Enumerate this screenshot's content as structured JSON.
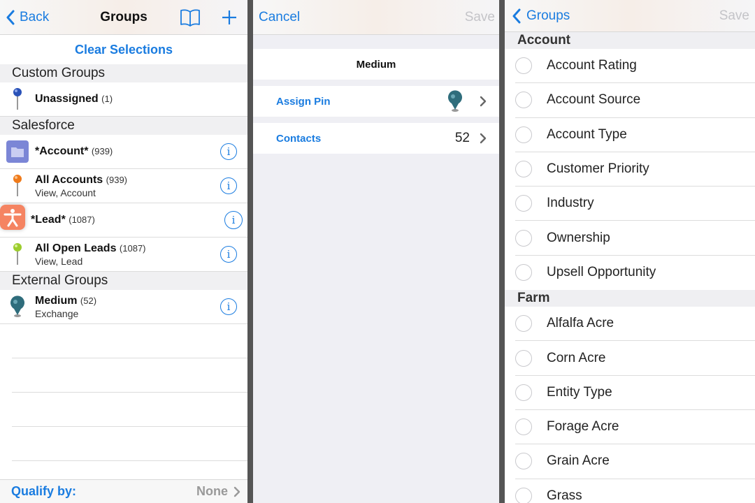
{
  "colors": {
    "accent": "#1a7ce0",
    "disabled": "#c4c4c8",
    "accessibility": "#f58462"
  },
  "groups_panel": {
    "back_label": "Back",
    "title": "Groups",
    "clear_label": "Clear Selections",
    "sections": [
      {
        "title": "Custom Groups",
        "items": [
          {
            "name": "Unassigned",
            "count": "(1)",
            "sub": "",
            "icon": "pin-blue-icon",
            "info": false
          }
        ]
      },
      {
        "title": "Salesforce",
        "items": [
          {
            "name": "*Account*",
            "count": "(939)",
            "sub": "",
            "icon": "folder-icon",
            "info": true
          },
          {
            "name": "All Accounts",
            "count": "(939)",
            "sub": "View, Account",
            "icon": "pin-orange-icon",
            "info": true
          },
          {
            "name": "*Lead*",
            "count": "(1087)",
            "sub": "",
            "icon": "",
            "info": true
          },
          {
            "name": "All Open Leads",
            "count": "(1087)",
            "sub": "View, Lead",
            "icon": "pin-green-icon",
            "info": true
          }
        ]
      },
      {
        "title": "External Groups",
        "items": [
          {
            "name": "Medium",
            "count": "(52)",
            "sub": "Exchange",
            "icon": "pin-teal-icon",
            "info": true
          }
        ]
      }
    ],
    "qualify_label": "Qualify by:",
    "qualify_value": "None"
  },
  "detail_panel": {
    "cancel_label": "Cancel",
    "save_label": "Save",
    "title": "Medium",
    "assign_pin_label": "Assign Pin",
    "contacts_label": "Contacts",
    "contacts_value": "52"
  },
  "fields_panel": {
    "back_label": "Groups",
    "save_label": "Save",
    "sections": [
      {
        "title": "Account",
        "items": [
          "Account Rating",
          "Account Source",
          "Account Type",
          "Customer Priority",
          "Industry",
          "Ownership",
          "Upsell Opportunity"
        ]
      },
      {
        "title": "Farm",
        "items": [
          "Alfalfa Acre",
          "Corn Acre",
          "Entity Type",
          "Forage Acre",
          "Grain Acre",
          "Grass"
        ]
      }
    ]
  }
}
